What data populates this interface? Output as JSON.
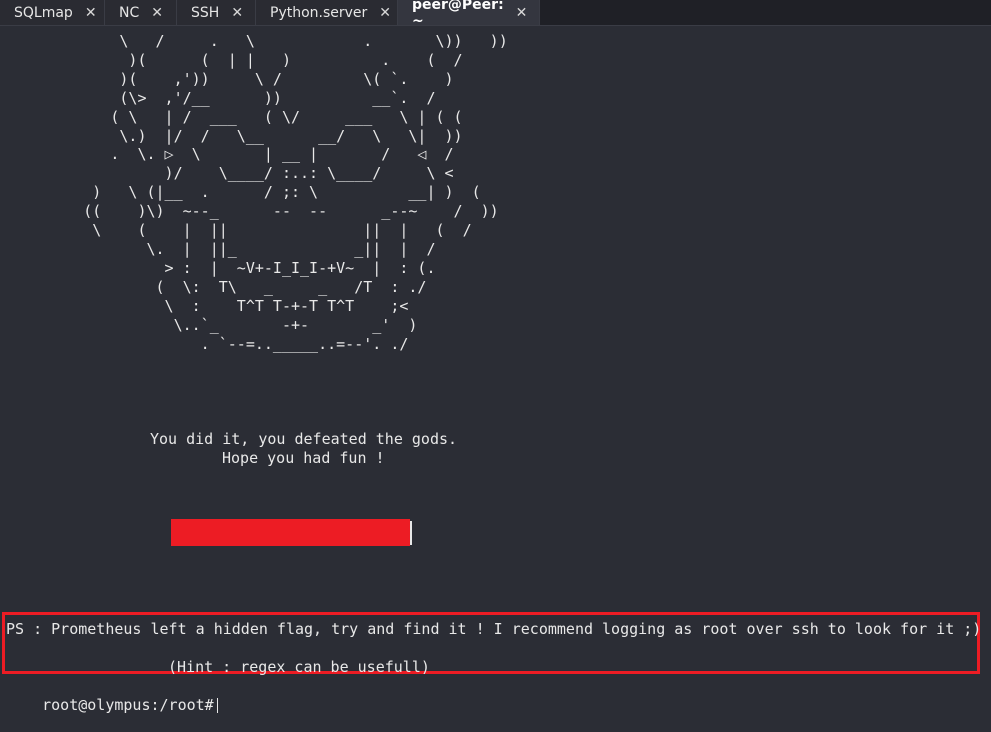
{
  "tabs": [
    {
      "label": "SQLmap",
      "close": "✕",
      "active": false
    },
    {
      "label": "NC",
      "close": "✕",
      "active": false
    },
    {
      "label": "SSH",
      "close": "✕",
      "active": false
    },
    {
      "label": "Python.server",
      "close": "✕",
      "active": false
    },
    {
      "label": "peer@Peer: ~",
      "close": "✕",
      "active": true
    }
  ],
  "terminal": {
    "ascii_art": "             \\   /     .   \\            .       \\))   ))\n              )(      (  | |   )          .    (  /\n             )(    ,'))     \\ /         \\( `.    )\n             (\\>  ,'/__      ))          __`.  /\n            ( \\   | /  ___   ( \\/     ___   \\ | ( (\n             \\.)  |/  /   \\__      __/   \\   \\|  ))\n            .  \\. ▷  \\       | __ |       /   ◁  /\n                  )/    \\____/ :..: \\____/     \\ <\n          )   \\ (|__  .      / ;: \\          __| )  (\n         ((    )\\)  ~--_      --  --      _--~    /  ))\n          \\    (    |  ||               ||  |   (  /\n                \\.  |  ||_             _||  |  /\n                  > :  |  ~V+-I_I_I-+V~  |  : (.\n                 (  \\:  T\\   _     _   /T  : ./\n                  \\  :    T^T T-+-T T^T    ;<\n                   \\..`_       -+-       _'  )\n                      . `--=.._____..=--'. ./",
    "victory_line1": "You did it, you defeated the gods.",
    "victory_line2": "Hope you had fun !",
    "ps_line": "PS : Prometheus left a hidden flag, try and find it ! I recommend logging as root over ssh to look for it ;)",
    "hint_line": "(Hint : regex can be usefull)",
    "prompt": "root@olympus:/root#",
    "redaction_color": "#ed1c24",
    "highlight_color": "#ed1c24"
  }
}
